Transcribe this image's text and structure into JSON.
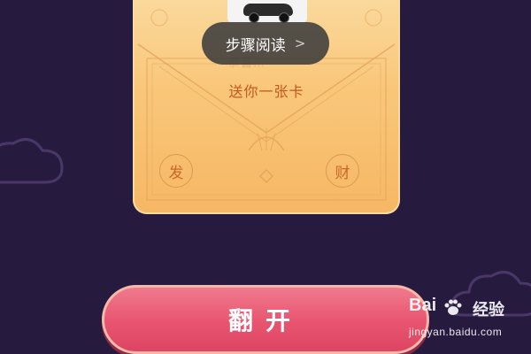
{
  "card": {
    "subtitle": "送你一张卡",
    "seal_left": "发",
    "seal_right": "财",
    "blurred_line": "恭喜…"
  },
  "overlay": {
    "read_label": "步骤阅读",
    "read_chevron": ">"
  },
  "action": {
    "flip_label": "翻开"
  },
  "watermark": {
    "brand": "Bai",
    "brand_cn": "经验",
    "url": "jingyan.baidu.com"
  },
  "colors": {
    "background": "#261a3f",
    "card_gold": "#f9c77a",
    "button_pink": "#e8546f",
    "accent_text": "#c2571f"
  }
}
